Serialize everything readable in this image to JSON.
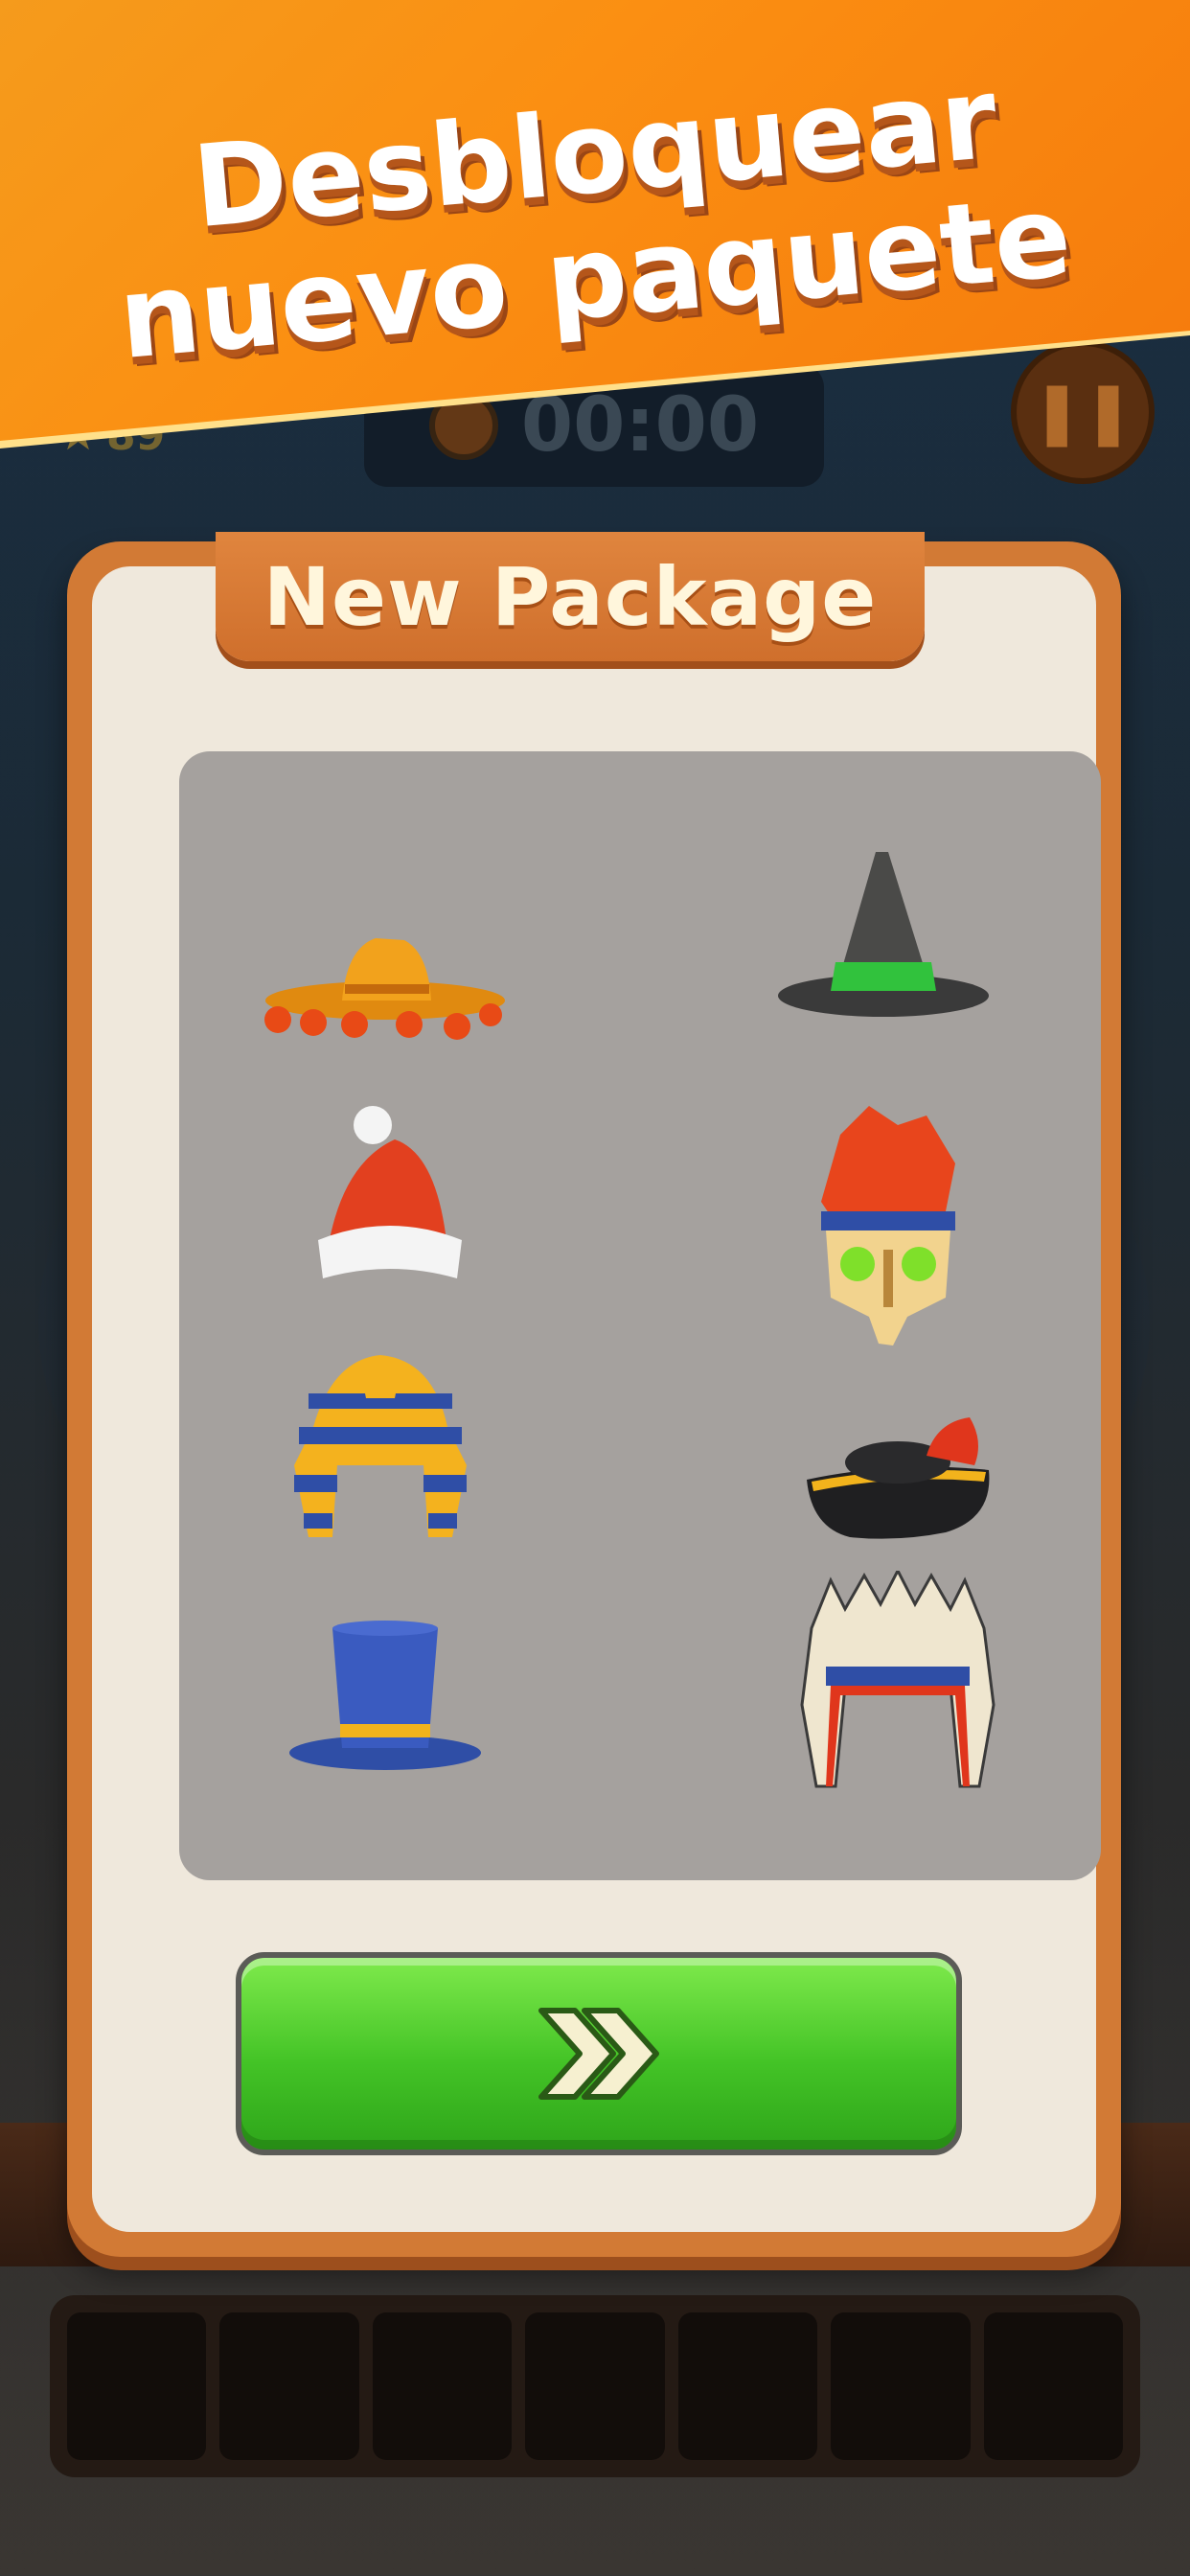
{
  "banner": {
    "line1": "Desbloquear",
    "line2": "nuevo paquete"
  },
  "hud": {
    "stars": "89",
    "timer": "00:00",
    "pause_icon": "pause-icon"
  },
  "modal": {
    "title": "New Package",
    "hats": [
      {
        "name": "sombrero-hat-icon"
      },
      {
        "name": "witch-hat-icon"
      },
      {
        "name": "santa-hat-icon"
      },
      {
        "name": "skull-feather-headdress-icon"
      },
      {
        "name": "pharaoh-headdress-icon"
      },
      {
        "name": "pirate-hat-icon"
      },
      {
        "name": "top-hat-icon"
      },
      {
        "name": "feather-headdress-icon"
      }
    ],
    "next_button_icon": "double-chevron-right-icon"
  },
  "colors": {
    "banner_orange": "#f58a12",
    "modal_frame": "#d27a35",
    "modal_bg": "#efe8dc",
    "grid_bg": "#a5a19e",
    "button_green": "#43c326"
  }
}
